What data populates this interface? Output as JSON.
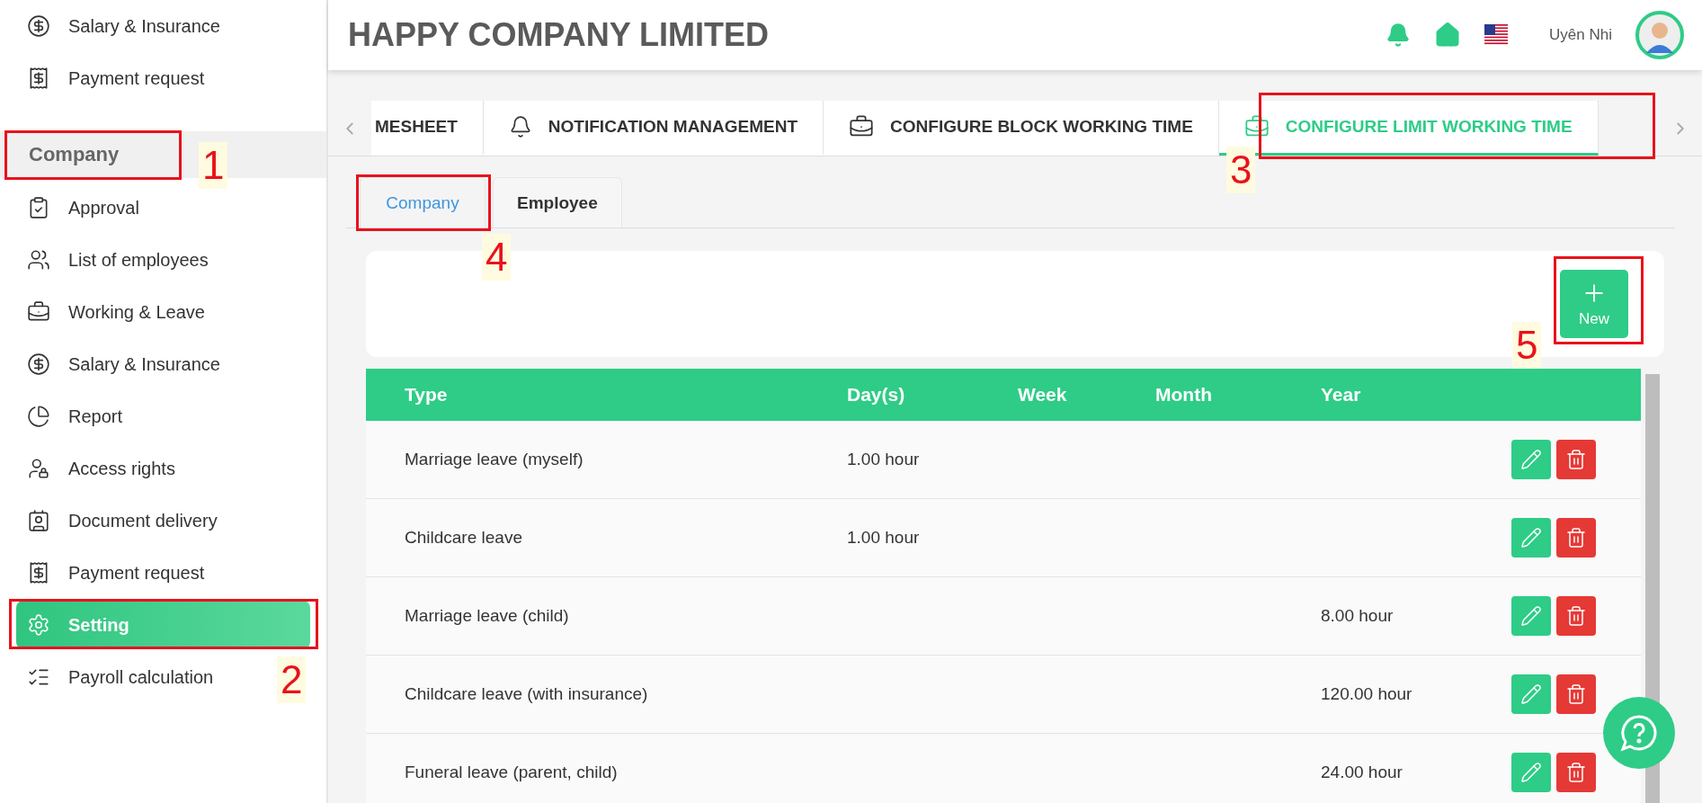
{
  "sidebar": {
    "top_items": [
      {
        "label": "Salary & Insurance"
      },
      {
        "label": "Payment request"
      }
    ],
    "section": {
      "label": "Company",
      "selected": true
    },
    "items": [
      {
        "label": "Approval",
        "selected": false
      },
      {
        "label": "List of employees",
        "selected": false
      },
      {
        "label": "Working & Leave",
        "selected": false
      },
      {
        "label": "Salary & Insurance",
        "selected": false
      },
      {
        "label": "Report",
        "selected": false
      },
      {
        "label": "Access rights",
        "selected": false
      },
      {
        "label": "Document delivery",
        "selected": false
      },
      {
        "label": "Payment request",
        "selected": false
      },
      {
        "label": "Setting",
        "selected": true
      },
      {
        "label": "Payroll calculation",
        "selected": false
      }
    ]
  },
  "header": {
    "title": "HAPPY COMPANY LIMITED",
    "user_name": "Uyên Nhi"
  },
  "tabs": [
    {
      "label": "MESHEET",
      "selected": false
    },
    {
      "label": "NOTIFICATION MANAGEMENT",
      "selected": false
    },
    {
      "label": "CONFIGURE BLOCK WORKING TIME",
      "selected": false
    },
    {
      "label": "CONFIGURE LIMIT WORKING TIME",
      "selected": true
    }
  ],
  "sub_tabs": [
    {
      "label": "Company",
      "selected": true
    },
    {
      "label": "Employee",
      "selected": false
    }
  ],
  "new_button": "New",
  "table": {
    "columns": [
      "Type",
      "Day(s)",
      "Week",
      "Month",
      "Year"
    ],
    "rows": [
      {
        "cells": [
          "Marriage leave (myself)",
          "1.00 hour",
          "",
          "",
          ""
        ]
      },
      {
        "cells": [
          "Childcare leave",
          "1.00 hour",
          "",
          "",
          ""
        ]
      },
      {
        "cells": [
          "Marriage leave (child)",
          "",
          "",
          "",
          "8.00 hour"
        ]
      },
      {
        "cells": [
          "Childcare leave (with insurance)",
          "",
          "",
          "",
          "120.00 hour"
        ]
      },
      {
        "cells": [
          "Funeral leave (parent, child)",
          "",
          "",
          "",
          "24.00 hour"
        ]
      }
    ]
  },
  "annotations": [
    {
      "label": "1"
    },
    {
      "label": "2"
    },
    {
      "label": "3"
    },
    {
      "label": "4"
    },
    {
      "label": "5"
    }
  ]
}
